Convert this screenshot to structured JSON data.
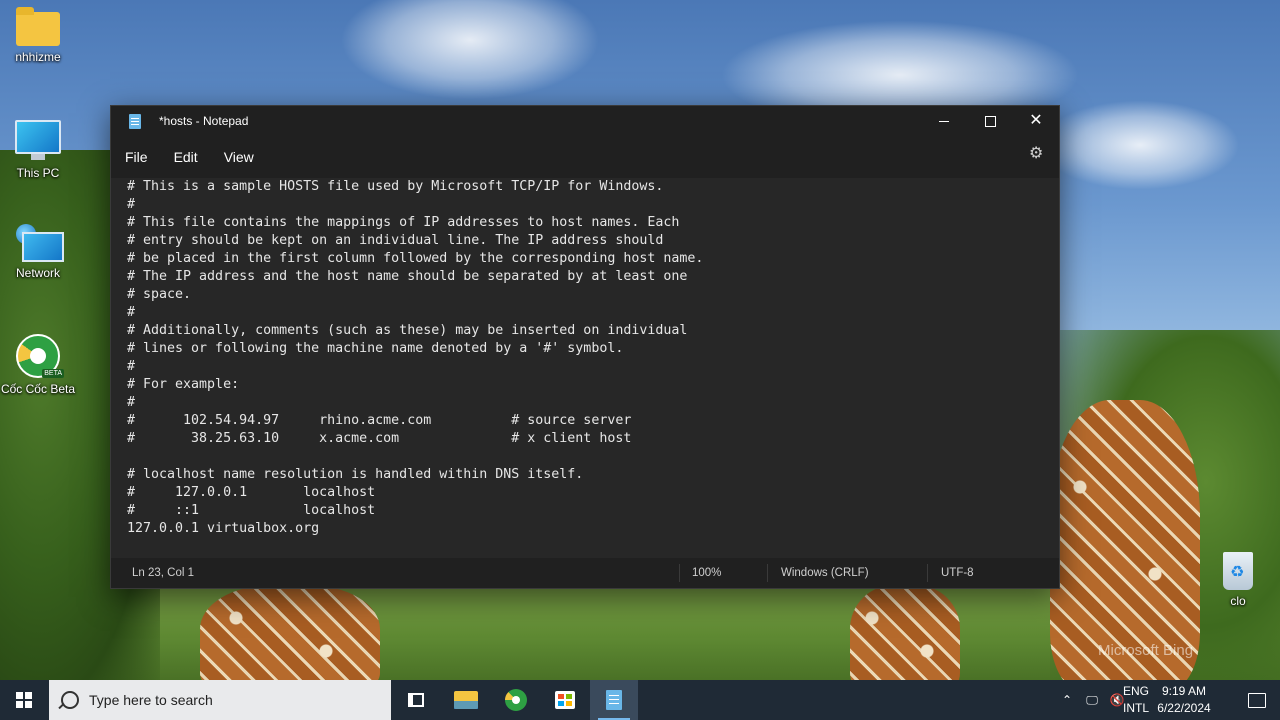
{
  "desktop": {
    "watermark": "Microsoft Bing",
    "icons": [
      {
        "label": "nhhizme",
        "icon": "folder-icon"
      },
      {
        "label": "This PC",
        "icon": "this-pc-icon"
      },
      {
        "label": "Network",
        "icon": "network-icon"
      },
      {
        "label": "Cốc Cốc Beta",
        "icon": "coccoc-beta-icon",
        "badge": "BETA"
      },
      {
        "label": "clo",
        "icon": "recycle-bin-icon"
      }
    ]
  },
  "window": {
    "title": "*hosts - Notepad",
    "controls": {
      "minimize": "minimize",
      "maximize": "maximize",
      "close": "✕"
    },
    "menu": [
      "File",
      "Edit",
      "View"
    ],
    "settings_icon": "gear-icon",
    "content_lines": [
      "# This is a sample HOSTS file used by Microsoft TCP/IP for Windows.",
      "#",
      "# This file contains the mappings of IP addresses to host names. Each",
      "# entry should be kept on an individual line. The IP address should",
      "# be placed in the first column followed by the corresponding host name.",
      "# The IP address and the host name should be separated by at least one",
      "# space.",
      "#",
      "# Additionally, comments (such as these) may be inserted on individual",
      "# lines or following the machine name denoted by a '#' symbol.",
      "#",
      "# For example:",
      "#",
      "#      102.54.94.97     rhino.acme.com          # source server",
      "#       38.25.63.10     x.acme.com              # x client host",
      "",
      "# localhost name resolution is handled within DNS itself.",
      "#\t127.0.0.1       localhost",
      "#\t::1             localhost",
      "127.0.0.1 virtualbox.org"
    ],
    "status": {
      "position": "Ln 23, Col 1",
      "zoom": "100%",
      "line_ending": "Windows (CRLF)",
      "encoding": "UTF-8"
    }
  },
  "taskbar": {
    "search_placeholder": "Type here to search",
    "pinned": [
      "task-view-icon",
      "file-explorer-icon",
      "coccoc-icon",
      "microsoft-store-icon",
      "notepad-icon"
    ],
    "active_app": "notepad-icon",
    "tray": {
      "language_line1": "ENG",
      "language_line2": "INTL",
      "time": "9:19 AM",
      "date": "6/22/2024"
    }
  }
}
